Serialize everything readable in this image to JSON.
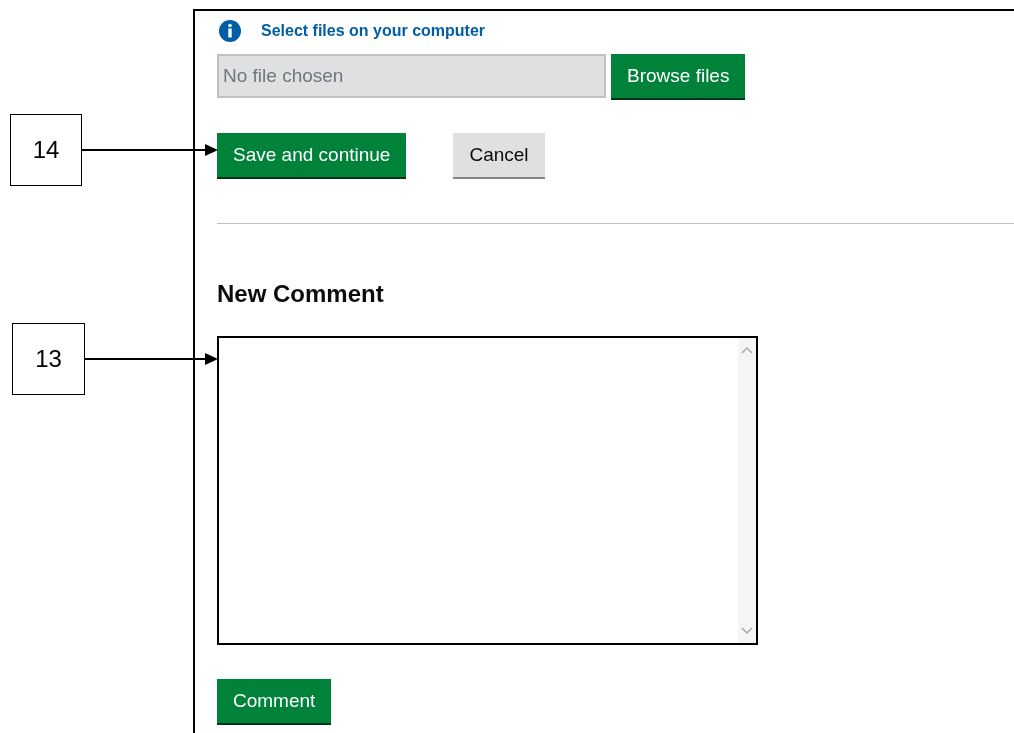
{
  "upload": {
    "hint": "Select files on your computer",
    "file_field": {
      "placeholder": "No file chosen"
    },
    "browse_button": "Browse files"
  },
  "actions": [
    {
      "label": "Save and continue",
      "kind": "primary"
    },
    {
      "label": "Cancel",
      "kind": "secondary"
    }
  ],
  "comment": {
    "heading": "New Comment",
    "submit": "Comment"
  },
  "callouts": [
    {
      "label": "14"
    },
    {
      "label": "13"
    }
  ]
}
